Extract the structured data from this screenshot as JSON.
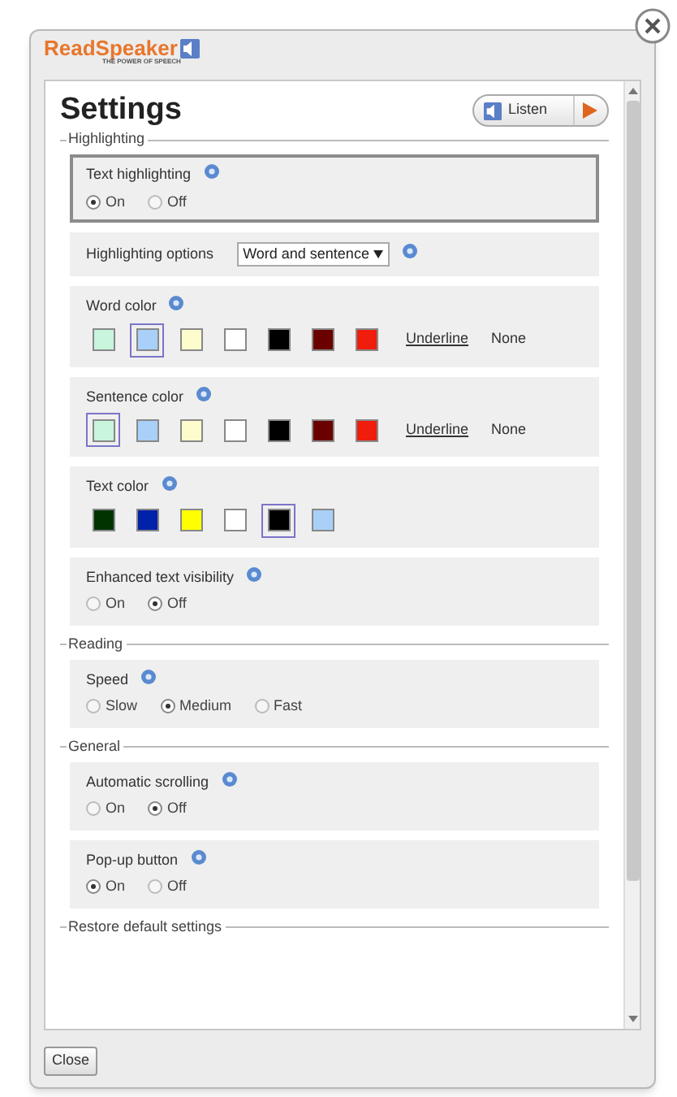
{
  "logo": {
    "name_part_1": "Read",
    "name_part_2": "Speaker",
    "tagline": "THE POWER OF SPEECH"
  },
  "title": "Settings",
  "listen_button": {
    "label": "Listen"
  },
  "sections": [
    {
      "title": "Highlighting",
      "settings": [
        {
          "kind": "radio",
          "label": "Text highlighting",
          "focused": true,
          "options": [
            {
              "label": "On",
              "selected": true
            },
            {
              "label": "Off",
              "selected": false
            }
          ]
        },
        {
          "kind": "select",
          "label": "Highlighting options",
          "focused": false,
          "value": "Word and sentence"
        },
        {
          "kind": "swatches",
          "label": "Word color",
          "focused": false,
          "swatches": [
            {
              "color": "#c8f5dc",
              "selected": false
            },
            {
              "color": "#a8d0f8",
              "selected": true
            },
            {
              "color": "#fdfccc",
              "selected": false
            },
            {
              "color": "#ffffff",
              "selected": false
            },
            {
              "color": "#000000",
              "selected": false
            },
            {
              "color": "#6b0000",
              "selected": false
            },
            {
              "color": "#f01c0c",
              "selected": false
            }
          ],
          "extras": [
            {
              "kind": "link",
              "label": "Underline"
            },
            {
              "kind": "text",
              "label": "None"
            }
          ]
        },
        {
          "kind": "swatches",
          "label": "Sentence color",
          "focused": false,
          "swatches": [
            {
              "color": "#c8f5dc",
              "selected": true
            },
            {
              "color": "#a8d0f8",
              "selected": false
            },
            {
              "color": "#fdfccc",
              "selected": false
            },
            {
              "color": "#ffffff",
              "selected": false
            },
            {
              "color": "#000000",
              "selected": false
            },
            {
              "color": "#6b0000",
              "selected": false
            },
            {
              "color": "#f01c0c",
              "selected": false
            }
          ],
          "extras": [
            {
              "kind": "link",
              "label": "Underline"
            },
            {
              "kind": "text",
              "label": "None"
            }
          ]
        },
        {
          "kind": "swatches",
          "label": "Text color",
          "focused": false,
          "swatches": [
            {
              "color": "#003300",
              "selected": false
            },
            {
              "color": "#0022aa",
              "selected": false
            },
            {
              "color": "#ffff00",
              "selected": false
            },
            {
              "color": "#ffffff",
              "selected": false
            },
            {
              "color": "#000000",
              "selected": true
            },
            {
              "color": "#a8d0f8",
              "selected": false
            }
          ]
        },
        {
          "kind": "radio",
          "label": "Enhanced text visibility",
          "focused": false,
          "options": [
            {
              "label": "On",
              "selected": false
            },
            {
              "label": "Off",
              "selected": true
            }
          ]
        }
      ]
    },
    {
      "title": "Reading",
      "settings": [
        {
          "kind": "radio",
          "label": "Speed",
          "focused": false,
          "options": [
            {
              "label": "Slow",
              "selected": false
            },
            {
              "label": "Medium",
              "selected": true
            },
            {
              "label": "Fast",
              "selected": false
            }
          ]
        }
      ]
    },
    {
      "title": "General",
      "settings": [
        {
          "kind": "radio",
          "label": "Automatic scrolling",
          "focused": false,
          "options": [
            {
              "label": "On",
              "selected": false
            },
            {
              "label": "Off",
              "selected": true
            }
          ]
        },
        {
          "kind": "radio",
          "label": "Pop-up button",
          "focused": false,
          "options": [
            {
              "label": "On",
              "selected": true
            },
            {
              "label": "Off",
              "selected": false
            }
          ]
        }
      ]
    },
    {
      "title": "Restore default settings"
    }
  ],
  "close_button": {
    "label": "Close"
  }
}
